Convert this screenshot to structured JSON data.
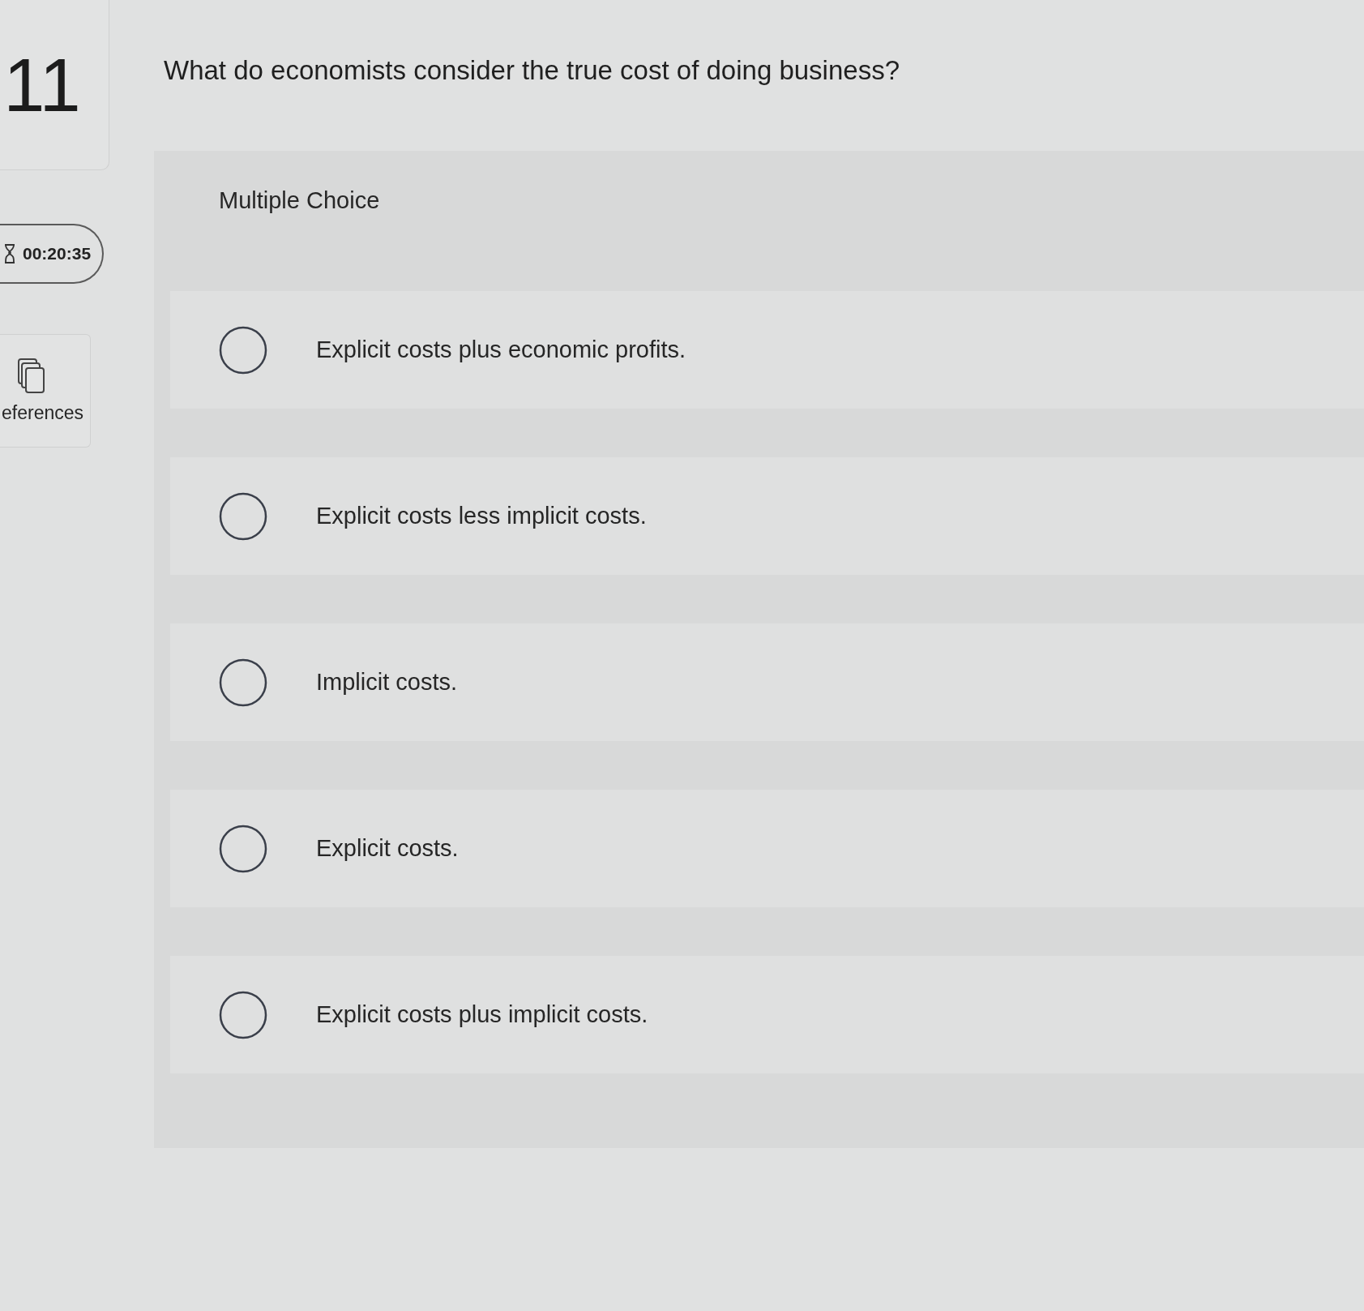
{
  "question_number": "11",
  "timer": {
    "time": "00:20:35"
  },
  "references": {
    "label": "eferences"
  },
  "question": "What do economists consider the true cost of doing business?",
  "answer_area": {
    "type_label": "Multiple Choice",
    "options": [
      {
        "label": "Explicit costs plus economic profits.",
        "selected": false
      },
      {
        "label": "Explicit costs less implicit costs.",
        "selected": false
      },
      {
        "label": "Implicit costs.",
        "selected": false
      },
      {
        "label": "Explicit costs.",
        "selected": false
      },
      {
        "label": "Explicit costs plus implicit costs.",
        "selected": false
      }
    ]
  }
}
